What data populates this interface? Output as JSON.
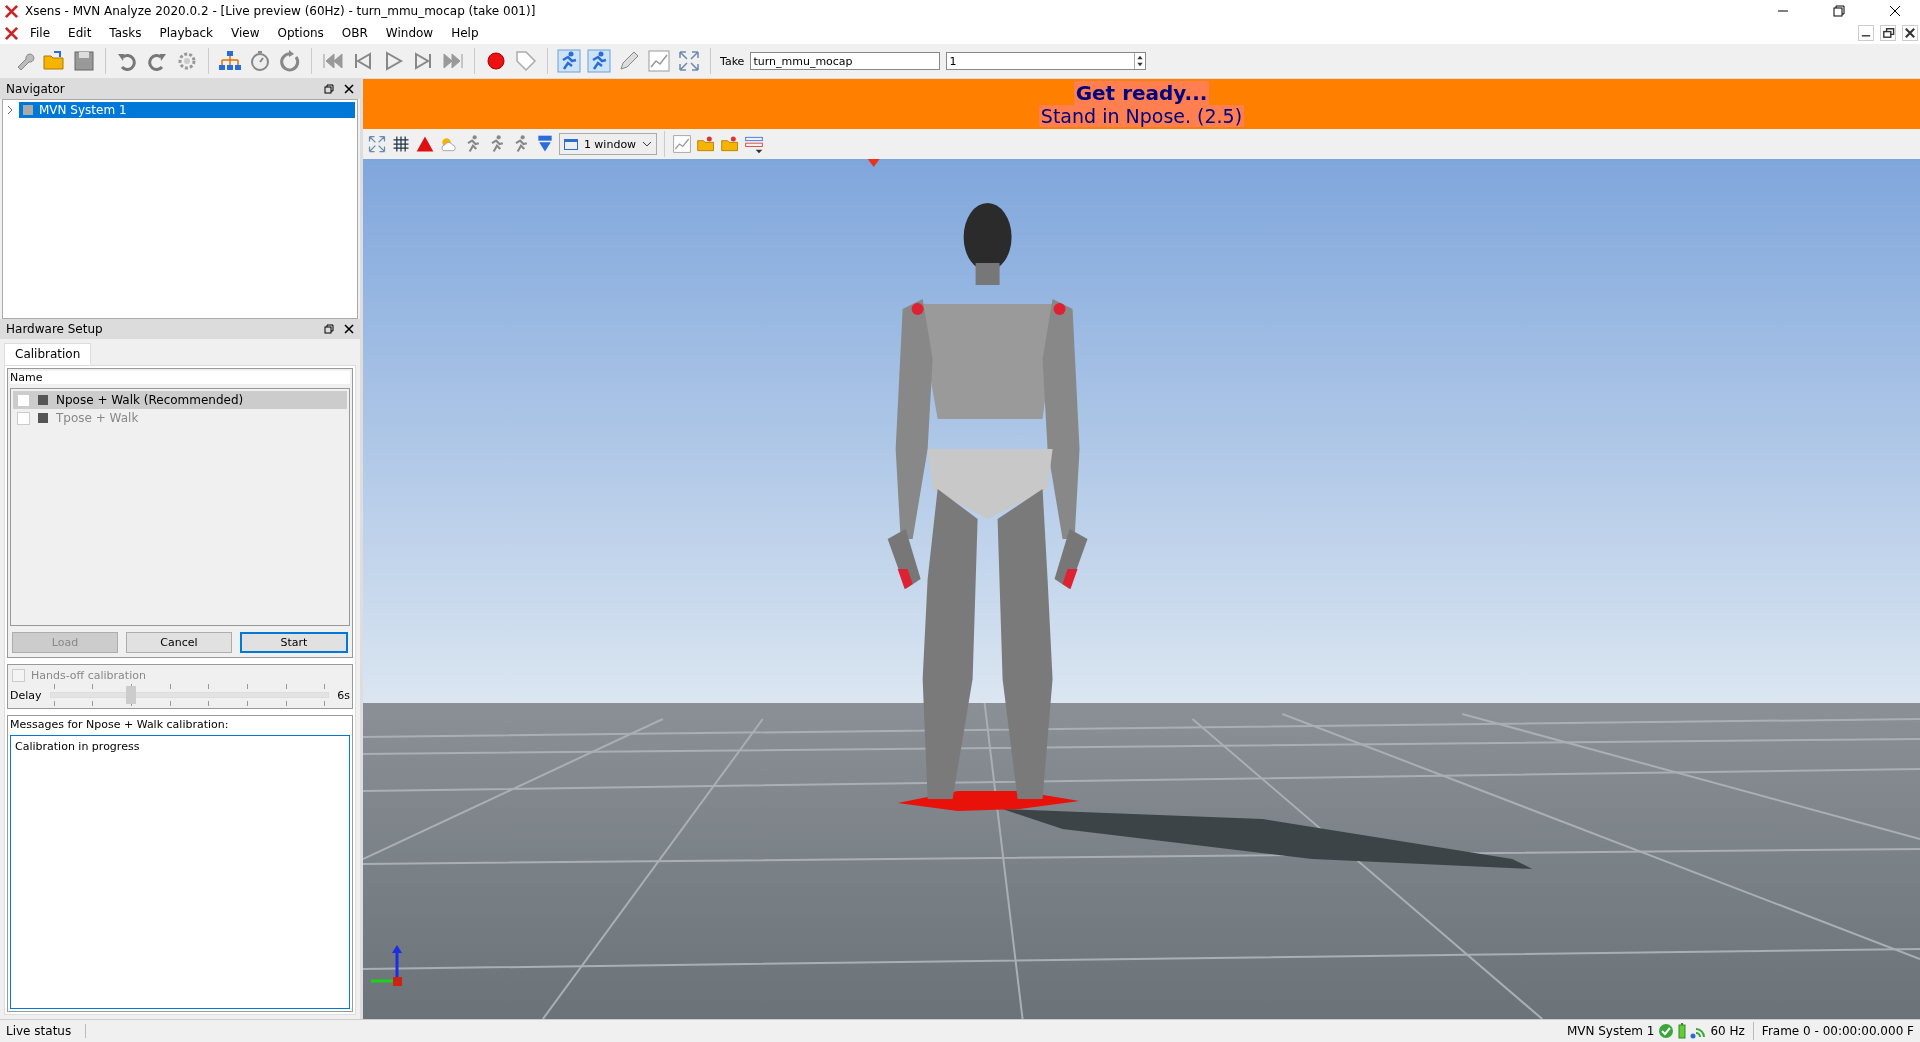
{
  "window": {
    "title": "Xsens - MVN Analyze 2020.0.2 - [Live preview (60Hz) - turn_mmu_mocap (take 001)]"
  },
  "menu": [
    "File",
    "Edit",
    "Tasks",
    "Playback",
    "View",
    "Options",
    "OBR",
    "Window",
    "Help"
  ],
  "toolbar": {
    "take_label": "Take",
    "take_name": "turn_mmu_mocap",
    "take_number": "1"
  },
  "navigator": {
    "title": "Navigator",
    "items": [
      {
        "label": "MVN System 1",
        "expanded": false,
        "selected": true
      }
    ]
  },
  "hardware_setup": {
    "title": "Hardware Setup",
    "tabs": [
      {
        "label": "Calibration",
        "selected": true
      }
    ],
    "list_header": "Name",
    "items": [
      {
        "label": "Npose + Walk (Recommended)",
        "checked": false,
        "disabled": false,
        "selected": true
      },
      {
        "label": "Tpose + Walk",
        "checked": false,
        "disabled": true,
        "selected": false
      }
    ],
    "buttons": [
      {
        "label": "Load",
        "disabled": true,
        "default": false
      },
      {
        "label": "Cancel",
        "disabled": false,
        "default": false
      },
      {
        "label": "Start",
        "disabled": false,
        "default": true
      }
    ],
    "hands_off": {
      "label": "Hands-off calibration",
      "checked": false,
      "disabled": true
    },
    "delay": {
      "label": "Delay",
      "level": 0.29,
      "reading": "6s"
    },
    "messages": {
      "title": "Messages for Npose + Walk calibration:",
      "text": "Calibration in progress"
    }
  },
  "banner": {
    "title": "Get ready...",
    "message": "Stand in Npose. (2.5)"
  },
  "view_toolbar": {
    "window_select": "1 window"
  },
  "status_bar": {
    "left": "Live status",
    "system": "MVN System 1",
    "rate": "60 Hz",
    "frame": "Frame 0 - 00:00:00.000 F"
  }
}
